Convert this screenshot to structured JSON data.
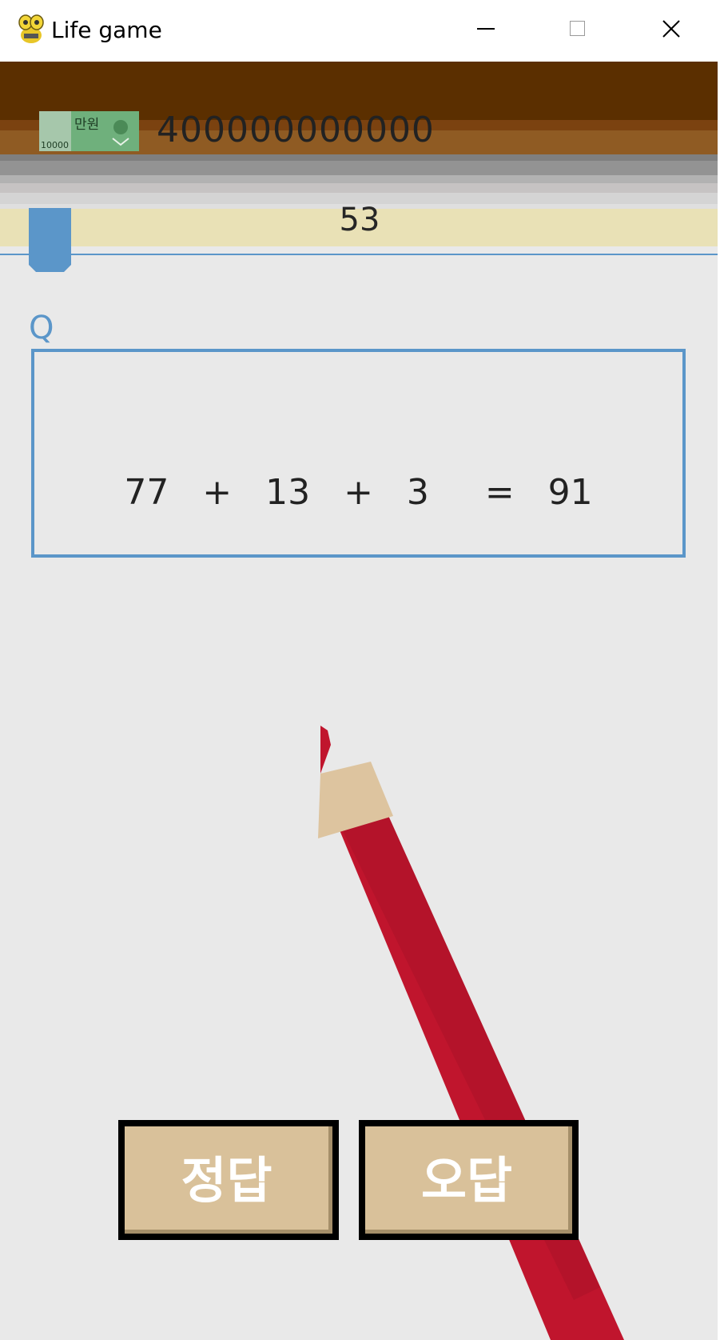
{
  "window": {
    "title": "Life game",
    "controls": [
      "minimize",
      "maximize",
      "close"
    ]
  },
  "status": {
    "money": "400000000000",
    "money_icon": "10000-won-banknote",
    "banknote_text": {
      "denomination": "10000",
      "label": "만원"
    },
    "timer": "53",
    "timer_progress_fraction": 0.06
  },
  "question": {
    "label": "Q",
    "expression": "77   +   13   +   3     =   91"
  },
  "buttons": {
    "correct": "정답",
    "wrong": "오답"
  },
  "colors": {
    "accent_blue": "#5b96c9",
    "header_brown": "#5b2f00",
    "button_face": "#d9c19a",
    "pencil_red": "#c0152d",
    "background": "#e9e9e9"
  }
}
